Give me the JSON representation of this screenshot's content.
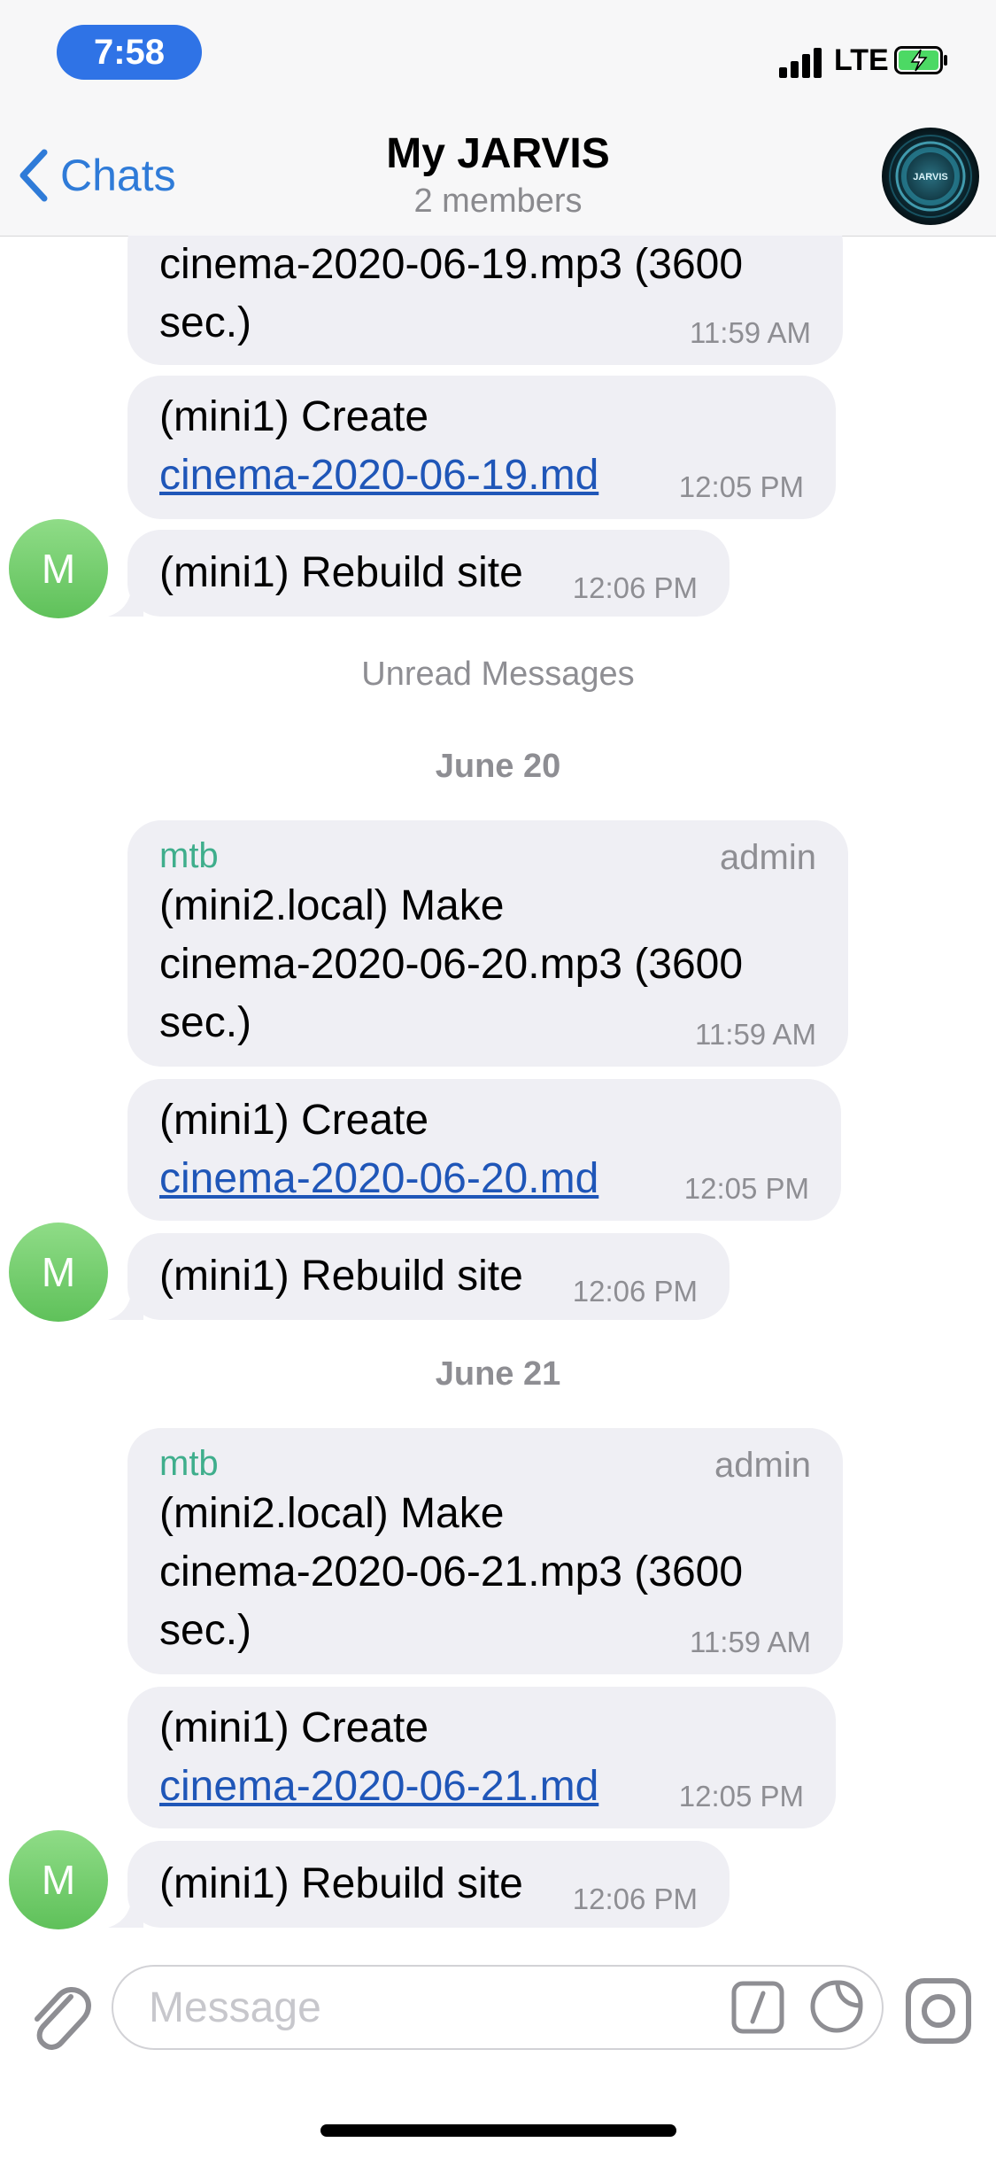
{
  "status_bar": {
    "time": "7:58",
    "network": "LTE",
    "accent_color": "#2f73e6",
    "battery_color": "#4cd964"
  },
  "nav": {
    "back_label": "Chats",
    "title": "My JARVIS",
    "subtitle": "2 members",
    "avatar_text": "JARVIS",
    "link_color": "#2f7bd8"
  },
  "messages": {
    "m1": {
      "text": "cinema-2020-06-19.mp3 (3600",
      "text2": "sec.)",
      "time": "11:59 AM"
    },
    "m2": {
      "text": "(mini1) Create",
      "link": "cinema-2020-06-19.md",
      "time": "12:05 PM"
    },
    "m3": {
      "avatar": "M",
      "text": "(mini1) Rebuild site",
      "time": "12:06 PM"
    },
    "unread": "Unread Messages",
    "date1": "June 20",
    "m4": {
      "sender": "mtb",
      "role": "admin",
      "line1": "(mini2.local) Make",
      "line2": "cinema-2020-06-20.mp3 (3600",
      "line3": "sec.)",
      "time": "11:59 AM"
    },
    "m5": {
      "text": "(mini1) Create",
      "link": "cinema-2020-06-20.md",
      "time": "12:05 PM"
    },
    "m6": {
      "avatar": "M",
      "text": "(mini1) Rebuild site",
      "time": "12:06 PM"
    },
    "date2": "June 21",
    "m7": {
      "sender": "mtb",
      "role": "admin",
      "line1": "(mini2.local) Make",
      "line2": "cinema-2020-06-21.mp3 (3600",
      "line3": "sec.)",
      "time": "11:59 AM"
    },
    "m8": {
      "text": "(mini1) Create",
      "link": "cinema-2020-06-21.md",
      "time": "12:05 PM"
    },
    "m9": {
      "avatar": "M",
      "text": "(mini1) Rebuild site",
      "time": "12:06 PM"
    }
  },
  "composer": {
    "placeholder": "Message"
  },
  "icons": {
    "back": "chevron-left-icon",
    "attach": "paperclip-icon",
    "command": "slash-command-icon",
    "sticker": "sticker-icon",
    "camera": "camera-icon"
  }
}
